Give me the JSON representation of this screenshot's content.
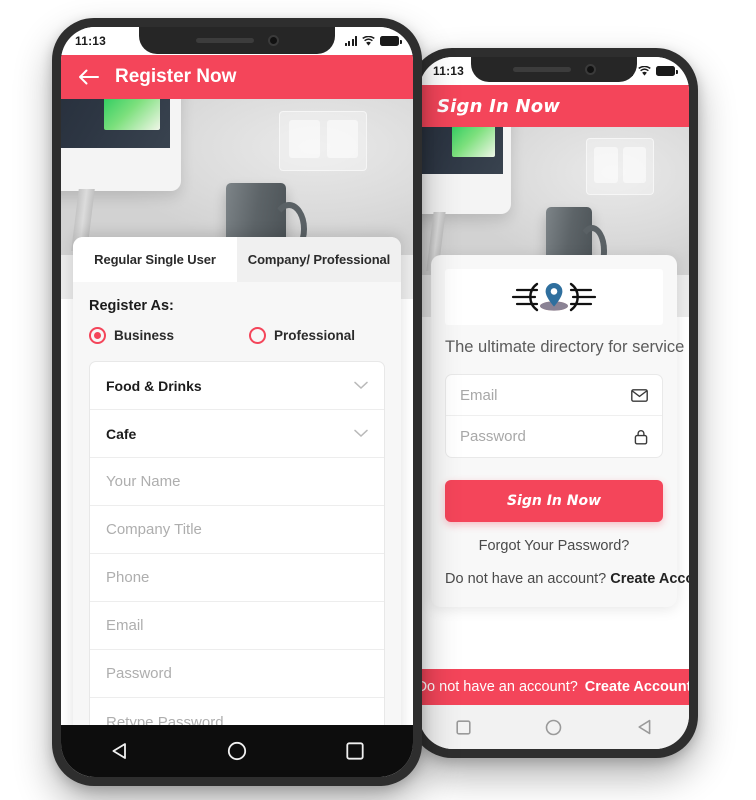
{
  "register_phone": {
    "status": {
      "time": "11:13",
      "signal_icon": "signal-bars-icon",
      "wifi_icon": "wifi-icon",
      "battery_icon": "battery-icon"
    },
    "appbar": {
      "back_icon": "back-arrow-icon",
      "title": "Register Now"
    },
    "tabs": [
      {
        "label": "Regular Single User",
        "active": true
      },
      {
        "label": "Company/ Professional",
        "active": false
      }
    ],
    "register_as_label": "Register As:",
    "radios": [
      {
        "label": "Business",
        "checked": true
      },
      {
        "label": "Professional",
        "checked": false
      }
    ],
    "fields": [
      {
        "type": "select",
        "value": "Food & Drinks",
        "icon": "chevron-down-icon"
      },
      {
        "type": "select",
        "value": "Cafe",
        "icon": "chevron-down-icon"
      },
      {
        "type": "text",
        "placeholder": "Your Name"
      },
      {
        "type": "text",
        "placeholder": "Company Title"
      },
      {
        "type": "text",
        "placeholder": "Phone"
      },
      {
        "type": "text",
        "placeholder": "Email"
      },
      {
        "type": "password",
        "placeholder": "Password"
      },
      {
        "type": "password",
        "placeholder": "Retype Password"
      }
    ],
    "nav": [
      "back-triangle-icon",
      "home-circle-icon",
      "recents-square-icon"
    ]
  },
  "signin_phone": {
    "status": {
      "time": "11:13",
      "signal_icon": "signal-bars-icon",
      "wifi_icon": "wifi-icon",
      "battery_icon": "battery-icon"
    },
    "appbar": {
      "title": "Sign In Now"
    },
    "logo_icon": "location-pin-logo-icon",
    "tagline": "The ultimate directory for service providers",
    "fields": [
      {
        "placeholder": "Email",
        "icon": "envelope-icon"
      },
      {
        "placeholder": "Password",
        "icon": "lock-icon"
      }
    ],
    "signin_button": "Sign In Now",
    "forgot_link": "Forgot Your Password?",
    "no_account_text": "Do not have an account?",
    "create_account_link": "Create Account",
    "bottom_cta": {
      "text": "Do not have an account?",
      "link": "Create Account"
    },
    "nav": [
      "recents-square-icon",
      "home-circle-icon",
      "back-triangle-icon"
    ]
  },
  "colors": {
    "brand_red": "#F4455A",
    "card_bg": "#F7F7F7",
    "placeholder": "#AEAEAE"
  }
}
